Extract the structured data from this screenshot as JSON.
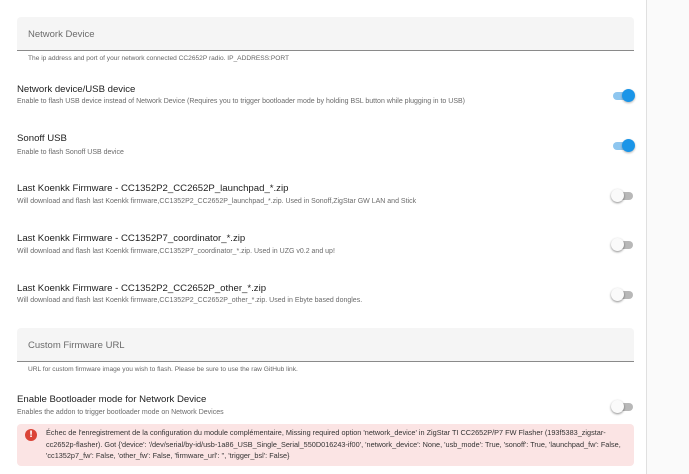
{
  "network_device_field": {
    "label": "Network Device",
    "helper": "The ip address and port of your network connected CC2652P radio. IP_ADDRESS:PORT"
  },
  "options": [
    {
      "title": "Network device/USB device",
      "description": "Enable to flash USB device instead of Network Device (Requires you to trigger bootloader mode by holding BSL button while plugging in to USB)",
      "enabled": true
    },
    {
      "title": "Sonoff USB",
      "description": "Enable to flash Sonoff USB device",
      "enabled": true
    },
    {
      "title": "Last Koenkk Firmware - CC1352P2_CC2652P_launchpad_*.zip",
      "description": "Will download and flash last Koenkk firmware,CC1352P2_CC2652P_launchpad_*.zip. Used in Sonoff,ZigStar GW LAN and Stick",
      "enabled": false
    },
    {
      "title": "Last Koenkk Firmware - CC1352P7_coordinator_*.zip",
      "description": "Will download and flash last Koenkk firmware,CC1352P7_coordinator_*.zip. Used in UZG v0.2 and up!",
      "enabled": false
    },
    {
      "title": "Last Koenkk Firmware - CC1352P2_CC2652P_other_*.zip",
      "description": "Will download and flash last Koenkk firmware,CC1352P2_CC2652P_other_*.zip. Used in Ebyte based dongles.",
      "enabled": false
    }
  ],
  "custom_firmware_field": {
    "label": "Custom Firmware URL",
    "helper": "URL for custom firmware image you wish to flash. Please be sure to use the raw GitHub link."
  },
  "bootloader_option": {
    "title": "Enable Bootloader mode for Network Device",
    "description": "Enables the addon to trigger bootloader mode on Network Devices",
    "enabled": false
  },
  "error": {
    "icon": "error-icon",
    "message": "Échec de l'enregistrement de la configuration du module complémentaire, Missing required option 'network_device' in ZigStar TI CC2652P/P7 FW Flasher (193f5383_zigstar-cc2652p-flasher). Got {'device': '/dev/serial/by-id/usb-1a86_USB_Single_Serial_550D016243-if00', 'network_device': None, 'usb_mode': True, 'sonoff': True, 'launchpad_fw': False, 'cc1352p7_fw': False, 'other_fw': False, 'firmware_url': '', 'trigger_bsl': False}"
  },
  "colors": {
    "accent": "#1a95e8",
    "error_bg": "#fbe4e4",
    "error_icon": "#db4437"
  }
}
